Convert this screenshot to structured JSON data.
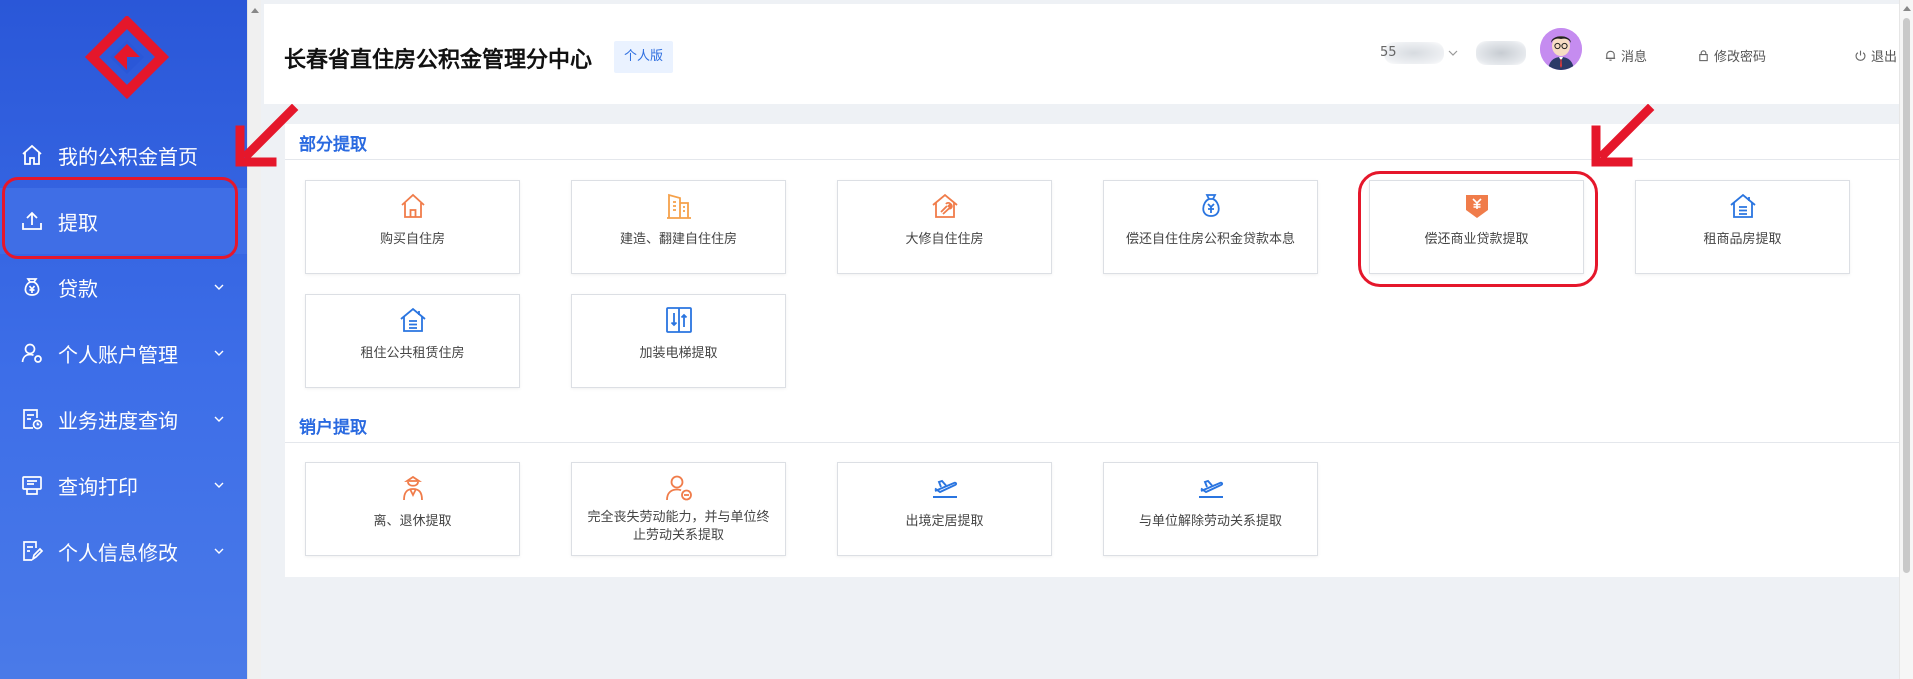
{
  "sidebar": {
    "items": [
      {
        "label": "我的公积金首页",
        "icon": "home-icon",
        "chevron": false
      },
      {
        "label": "提取",
        "icon": "upload-icon",
        "chevron": false,
        "active": true
      },
      {
        "label": "贷款",
        "icon": "yen-bag-icon",
        "chevron": true
      },
      {
        "label": "个人账户管理",
        "icon": "user-settings-icon",
        "chevron": true
      },
      {
        "label": "业务进度查询",
        "icon": "document-clock-icon",
        "chevron": true
      },
      {
        "label": "查询打印",
        "icon": "printer-icon",
        "chevron": true
      },
      {
        "label": "个人信息修改",
        "icon": "edit-document-icon",
        "chevron": true
      }
    ]
  },
  "header": {
    "title": "长春省直住房公积金管理分中心",
    "badge": "个人版",
    "user_prefix": "55",
    "links": {
      "messages": "消息",
      "change_password": "修改密码",
      "logout": "退出"
    }
  },
  "sections": [
    {
      "title": "部分提取",
      "cards": [
        {
          "label": "购买自住房",
          "icon": "house-icon"
        },
        {
          "label": "建造、翻建自住住房",
          "icon": "building-icon"
        },
        {
          "label": "大修自住住房",
          "icon": "house-wrench-icon"
        },
        {
          "label": "偿还自住住房公积金贷款本息",
          "icon": "money-bag-icon"
        },
        {
          "label": "偿还商业贷款提取",
          "icon": "yen-tag-icon"
        },
        {
          "label": "租商品房提取",
          "icon": "house-list-icon"
        },
        {
          "label": "租住公共租赁住房",
          "icon": "house-list-icon"
        },
        {
          "label": "加装电梯提取",
          "icon": "elevator-icon"
        }
      ]
    },
    {
      "title": "销户提取",
      "cards": [
        {
          "label": "离、退休提取",
          "icon": "retiree-icon"
        },
        {
          "label": "完全丧失劳动能力，并与单位终止劳动关系提取",
          "icon": "user-minus-icon"
        },
        {
          "label": "出境定居提取",
          "icon": "plane-icon"
        },
        {
          "label": "与单位解除劳动关系提取",
          "icon": "plane-icon"
        }
      ]
    }
  ],
  "colors": {
    "sidebar_top": "#2a57d8",
    "accent": "#2a6ae0",
    "highlight": "#e5172b",
    "orange_icon": "#f07c4a",
    "blue_icon": "#2a75e0"
  }
}
